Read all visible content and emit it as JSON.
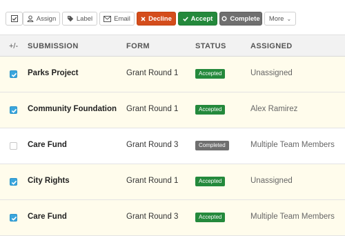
{
  "toolbar": {
    "assign_label": "Assign",
    "label_label": "Label",
    "email_label": "Email",
    "decline_label": "Decline",
    "accept_label": "Accept",
    "complete_label": "Complete",
    "more_label": "More"
  },
  "table": {
    "toggle_header": "+/-",
    "headers": {
      "submission": "SUBMISSION",
      "form": "FORM",
      "status": "STATUS",
      "assigned": "ASSIGNED"
    },
    "rows": [
      {
        "checked": true,
        "submission": "Parks Project",
        "form": "Grant Round 1",
        "status": "Accepted",
        "assigned": "Unassigned"
      },
      {
        "checked": true,
        "submission": "Community Foundation",
        "form": "Grant Round 1",
        "status": "Accepted",
        "assigned": "Alex Ramirez"
      },
      {
        "checked": false,
        "submission": "Care Fund",
        "form": "Grant Round 3",
        "status": "Completed",
        "assigned": "Multiple Team Members"
      },
      {
        "checked": true,
        "submission": "City Rights",
        "form": "Grant Round 1",
        "status": "Accepted",
        "assigned": "Unassigned"
      },
      {
        "checked": true,
        "submission": "Care Fund",
        "form": "Grant Round 3",
        "status": "Accepted",
        "assigned": "Multiple Team Members"
      }
    ]
  },
  "colors": {
    "decline": "#d44d1c",
    "accept": "#24893c",
    "complete": "#6f6f6f",
    "checkbox": "#3aa6dd",
    "selected_row": "#fffcec"
  }
}
